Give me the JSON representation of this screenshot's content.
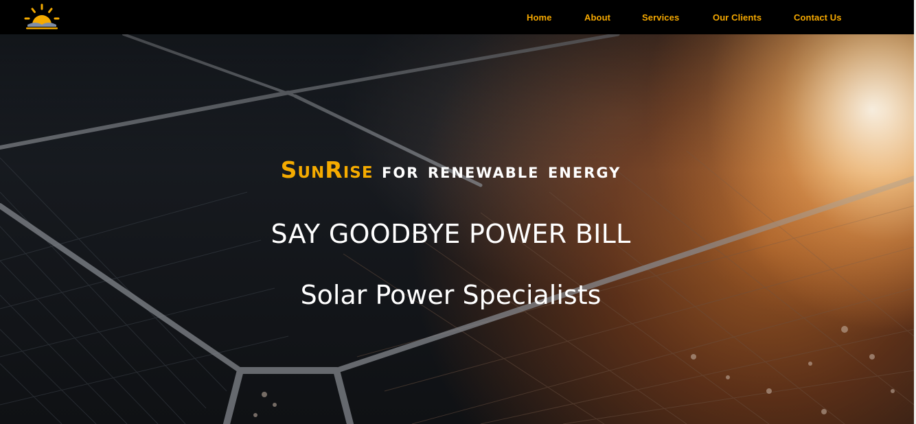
{
  "brand": {
    "logo_icon": "sunrise-icon",
    "accent_color": "#f5ab00"
  },
  "nav": {
    "items": [
      {
        "label": "Home"
      },
      {
        "label": "About"
      },
      {
        "label": "Services"
      },
      {
        "label": "Our Clients"
      },
      {
        "label": "Contact Us"
      }
    ],
    "link_color": "#f5a800",
    "background": "#000000"
  },
  "hero": {
    "brand_name": "SunRise",
    "headline_rest": "for renewable energy",
    "tagline": "SAY GOODBYE POWER BILL",
    "subtagline": "Solar Power Specialists",
    "background_image": "solar-panel-sunset-photo"
  }
}
